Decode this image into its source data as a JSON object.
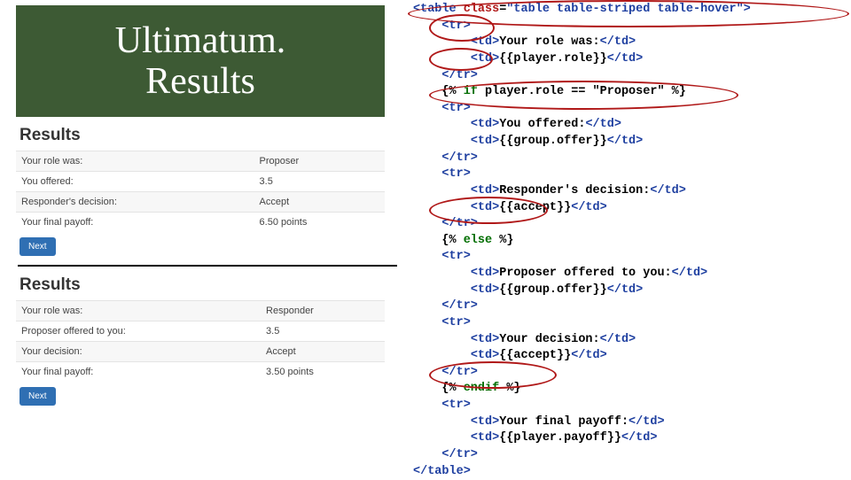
{
  "title_line1": "Ultimatum.",
  "title_line2": "Results",
  "panel_proposer": {
    "heading": "Results",
    "rows": [
      {
        "label": "Your role was:",
        "value": "Proposer"
      },
      {
        "label": "You offered:",
        "value": "3.5"
      },
      {
        "label": "Responder's decision:",
        "value": "Accept"
      },
      {
        "label": "Your final payoff:",
        "value": "6.50 points"
      }
    ],
    "button": "Next"
  },
  "panel_responder": {
    "heading": "Results",
    "rows": [
      {
        "label": "Your role was:",
        "value": "Responder"
      },
      {
        "label": "Proposer offered to you:",
        "value": "3.5"
      },
      {
        "label": "Your decision:",
        "value": "Accept"
      },
      {
        "label": "Your final payoff:",
        "value": "3.50 points"
      }
    ],
    "button": "Next"
  },
  "code_tokens": {
    "table_open_1": "<table",
    "table_cls_attr": " class",
    "eq": "=",
    "table_cls_val": "\"table table-striped table-hover\"",
    "gt": ">",
    "tr_open": "<tr>",
    "tr_close": "</tr>",
    "td_open": "<td>",
    "td_close": "</td>",
    "table_close": "</table>",
    "row_role_label": "Your role was:",
    "row_role_val": "{{player.role}}",
    "if_open": "{%",
    "if_kw": " if ",
    "if_cond": "player.role == \"Proposer\" ",
    "pct_close": "%}",
    "row_offer_label": "You offered:",
    "row_offer_val": "{{group.offer}}",
    "row_respdec_label": "Responder's decision:",
    "row_accept_val": "{{accept}}",
    "else_kw": " else ",
    "row_propoffer_label": "Proposer offered to you:",
    "row_yourdec_label": "Your decision:",
    "endif_kw": " endif ",
    "row_payoff_label": "Your final payoff:",
    "row_payoff_val": "{{player.payoff}}"
  }
}
